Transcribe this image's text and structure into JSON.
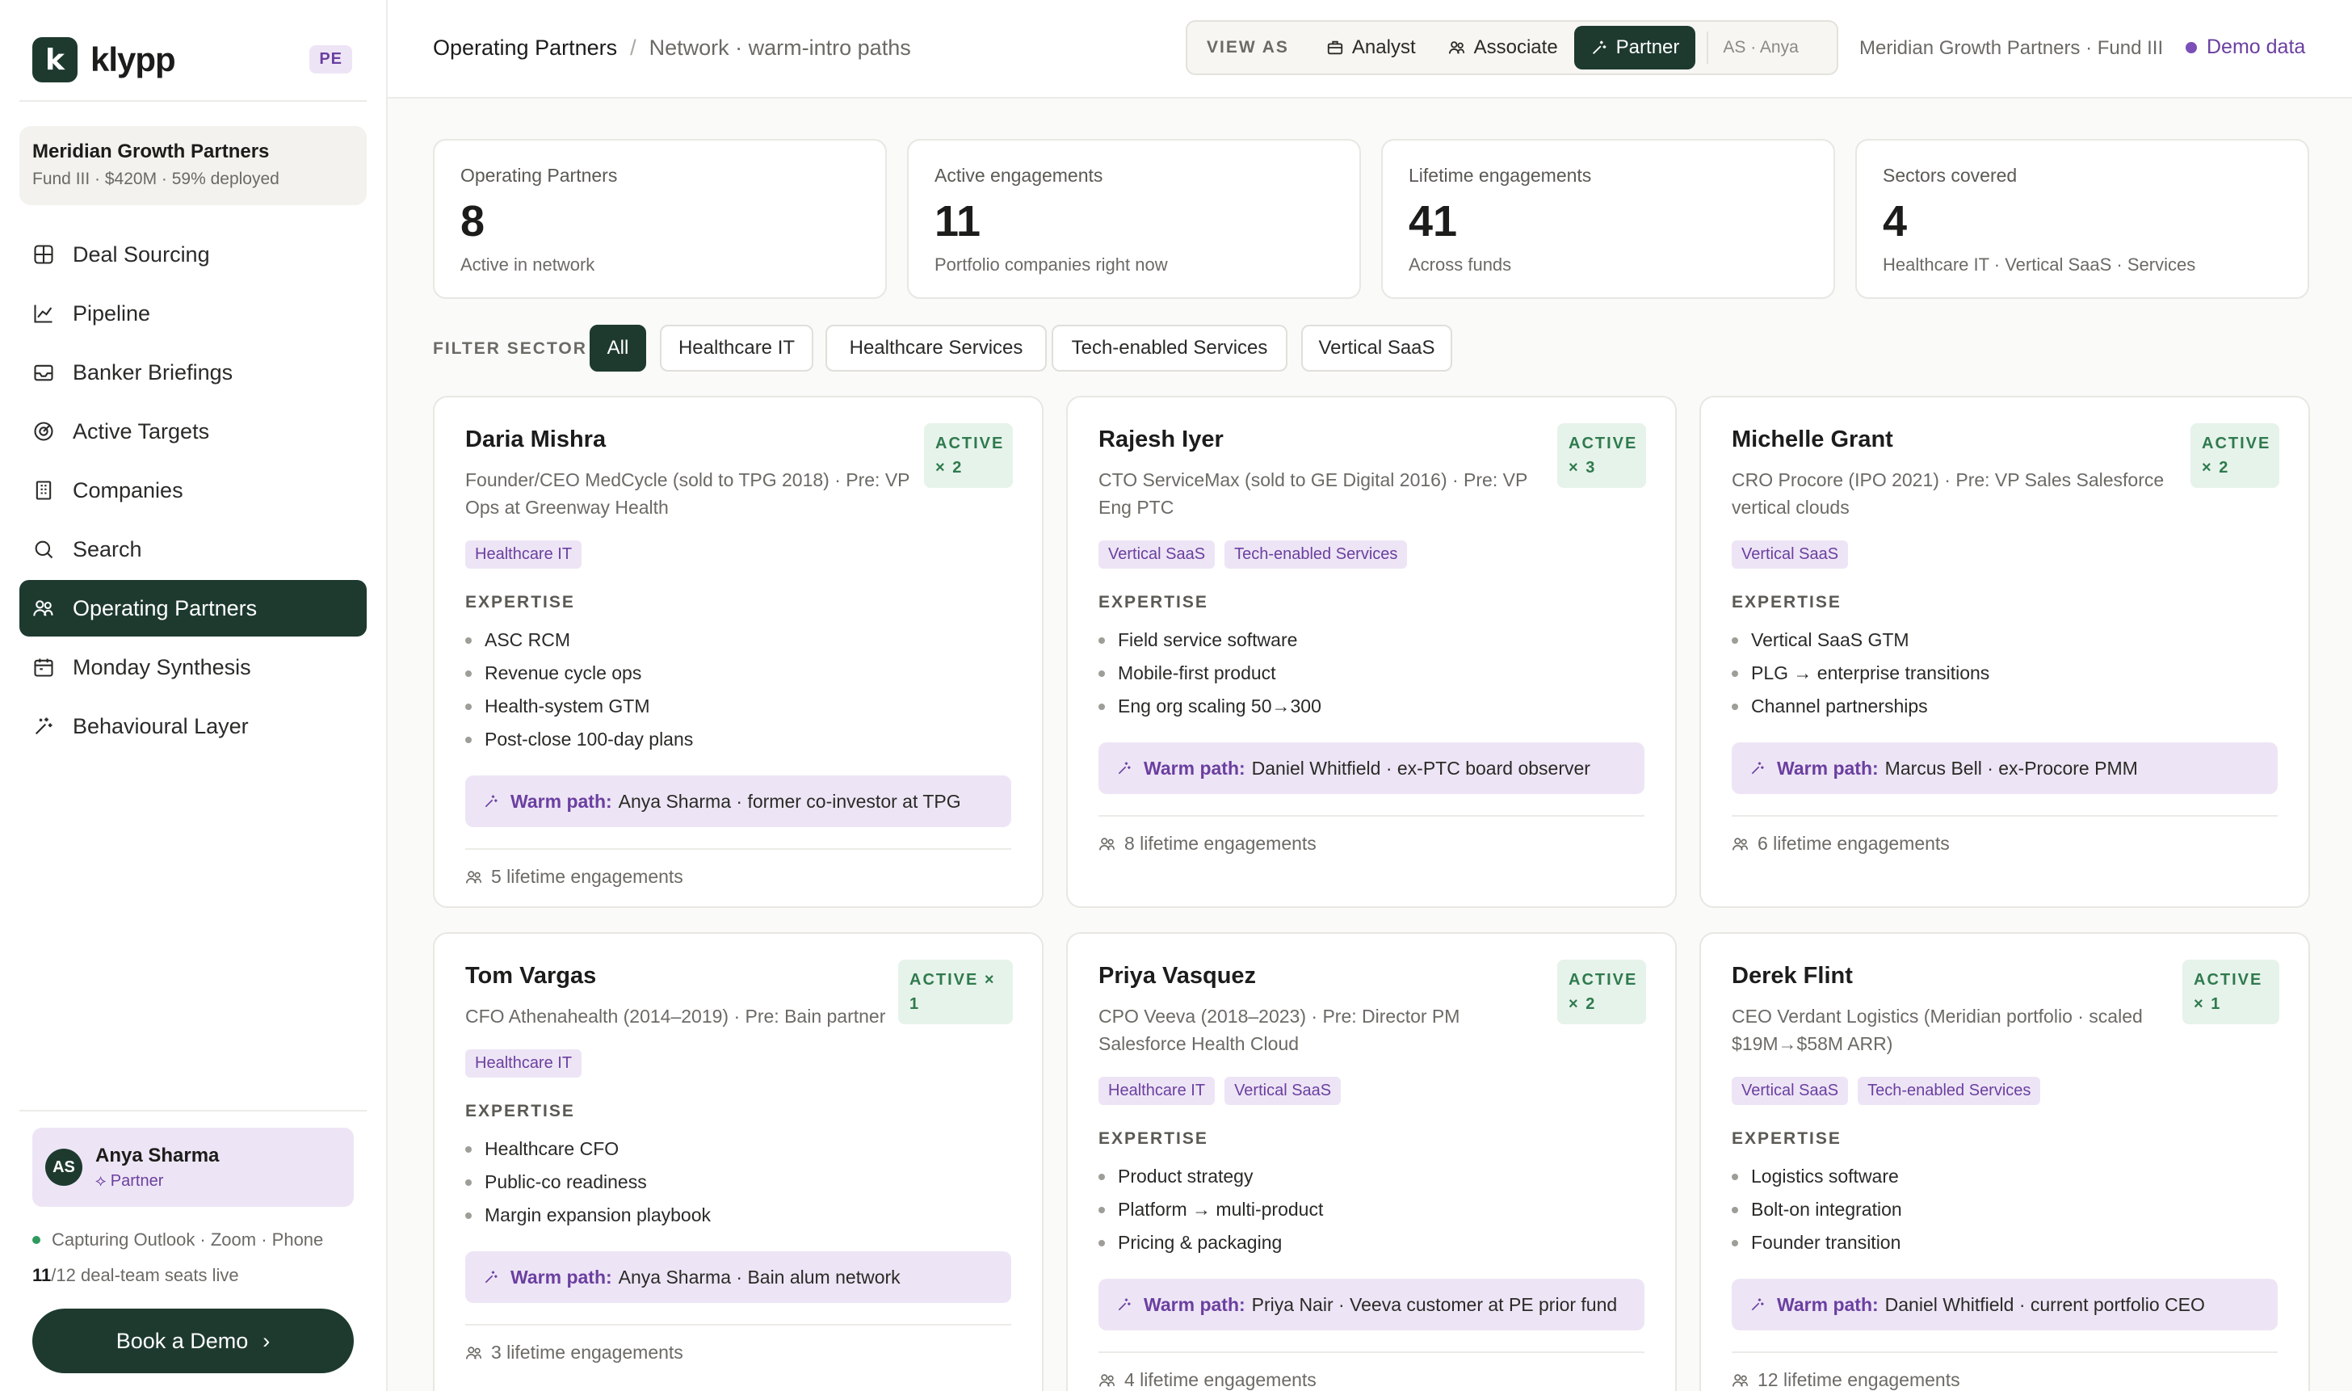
{
  "sidebar": {
    "logo_letter": "k",
    "logo_text": "klypp",
    "badge": "PE",
    "fund": {
      "name": "Meridian Growth Partners",
      "sub": "Fund III · $420M · 59% deployed"
    },
    "nav": [
      {
        "label": "Deal Sourcing",
        "icon": "grid-icon"
      },
      {
        "label": "Pipeline",
        "icon": "trend-chart-icon"
      },
      {
        "label": "Banker Briefings",
        "icon": "inbox-icon"
      },
      {
        "label": "Active Targets",
        "icon": "target-icon"
      },
      {
        "label": "Companies",
        "icon": "building-icon"
      },
      {
        "label": "Search",
        "icon": "search-icon"
      },
      {
        "label": "Operating Partners",
        "icon": "people-icon",
        "active": true
      },
      {
        "label": "Monday Synthesis",
        "icon": "calendar-icon"
      },
      {
        "label": "Behavioural Layer",
        "icon": "sparkle-icon"
      }
    ],
    "user": {
      "initials": "AS",
      "name": "Anya Sharma",
      "role": "Partner"
    },
    "capture": "Capturing Outlook · Zoom · Phone",
    "seats_count": "11",
    "seats_total": "/12",
    "seats_text": " deal-team seats live",
    "cta": "Book a Demo",
    "cta_arrow": "›"
  },
  "header": {
    "crumb_main": "Operating Partners",
    "crumb_sep": "/",
    "crumb_sub": "Network · warm-intro paths",
    "view_as_label": "VIEW AS",
    "view_as": [
      {
        "label": "Analyst",
        "icon": "briefcase-icon"
      },
      {
        "label": "Associate",
        "icon": "people-icon"
      },
      {
        "label": "Partner",
        "icon": "sparkle-icon",
        "active": true
      }
    ],
    "view_as_who": "AS · Anya",
    "fund": "Meridian Growth Partners · Fund III",
    "demo_data": "Demo data"
  },
  "stats": [
    {
      "label": "Operating Partners",
      "value": "8",
      "sub": "Active in network"
    },
    {
      "label": "Active engagements",
      "value": "11",
      "sub": "Portfolio companies right now"
    },
    {
      "label": "Lifetime engagements",
      "value": "41",
      "sub": "Across funds"
    },
    {
      "label": "Sectors covered",
      "value": "4",
      "sub": "Healthcare IT · Vertical SaaS · Services"
    }
  ],
  "filter": {
    "label": "FILTER SECTOR",
    "chips": [
      "All",
      "Healthcare IT",
      "Healthcare Services",
      "Tech-enabled Services",
      "Vertical SaaS"
    ],
    "active": "All"
  },
  "partners": [
    {
      "name": "Daria Mishra",
      "title": "Founder/CEO MedCycle (sold to TPG 2018) · Pre: VP Ops at Greenway Health",
      "badge": "ACTIVE × 2",
      "tags": [
        "Healthcare IT"
      ],
      "expertise": [
        "ASC RCM",
        "Revenue cycle ops",
        "Health-system GTM",
        "Post-close 100-day plans"
      ],
      "warm": "Anya Sharma · former co-investor at TPG",
      "lifetime": "5 lifetime engagements"
    },
    {
      "name": "Rajesh Iyer",
      "title": "CTO ServiceMax (sold to GE Digital 2016) · Pre: VP Eng PTC",
      "badge": "ACTIVE × 3",
      "tags": [
        "Vertical SaaS",
        "Tech-enabled Services"
      ],
      "expertise": [
        "Field service software",
        "Mobile-first product",
        "Eng org scaling 50→300"
      ],
      "warm": "Daniel Whitfield · ex-PTC board observer",
      "lifetime": "8 lifetime engagements"
    },
    {
      "name": "Michelle Grant",
      "title": "CRO Procore (IPO 2021) · Pre: VP Sales Salesforce vertical clouds",
      "badge": "ACTIVE × 2",
      "tags": [
        "Vertical SaaS"
      ],
      "expertise": [
        "Vertical SaaS GTM",
        "PLG → enterprise transitions",
        "Channel partnerships"
      ],
      "warm": "Marcus Bell · ex-Procore PMM",
      "lifetime": "6 lifetime engagements"
    },
    {
      "name": "Tom Vargas",
      "title": "CFO Athenahealth (2014–2019) · Pre: Bain partner",
      "badge": "ACTIVE × 1",
      "tags": [
        "Healthcare IT"
      ],
      "expertise": [
        "Healthcare CFO",
        "Public-co readiness",
        "Margin expansion playbook"
      ],
      "warm": "Anya Sharma · Bain alum network",
      "lifetime": "3 lifetime engagements"
    },
    {
      "name": "Priya Vasquez",
      "title": "CPO Veeva (2018–2023) · Pre: Director PM Salesforce Health Cloud",
      "badge": "ACTIVE × 2",
      "tags": [
        "Healthcare IT",
        "Vertical SaaS"
      ],
      "expertise": [
        "Product strategy",
        "Platform → multi-product",
        "Pricing & packaging"
      ],
      "warm": "Priya Nair · Veeva customer at PE prior fund",
      "lifetime": "4 lifetime engagements"
    },
    {
      "name": "Derek Flint",
      "title": "CEO Verdant Logistics (Meridian portfolio · scaled $19M→$58M ARR)",
      "badge": "ACTIVE × 1",
      "tags": [
        "Vertical SaaS",
        "Tech-enabled Services"
      ],
      "expertise": [
        "Logistics software",
        "Bolt-on integration",
        "Founder transition"
      ],
      "warm": "Daniel Whitfield · current portfolio CEO",
      "lifetime": "12 lifetime engagements"
    }
  ],
  "warm_label": "Warm path:",
  "expertise_label": "EXPERTISE",
  "colors": {
    "accent": "#1e3a2f",
    "purple": "#6b3fa0",
    "purple_bg": "#ede5f5",
    "green": "#2f7a4e",
    "green_bg": "#e6f3ea"
  }
}
